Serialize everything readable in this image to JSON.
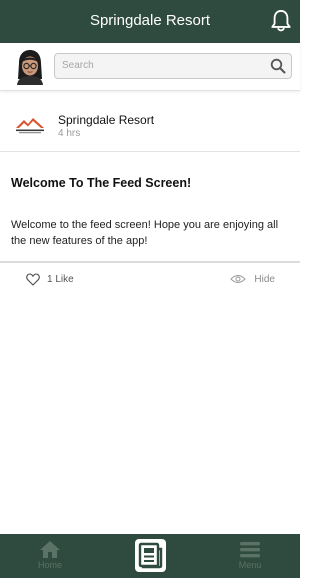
{
  "header": {
    "title": "Springdale Resort"
  },
  "search": {
    "placeholder": "Search"
  },
  "post": {
    "author": "Springdale Resort",
    "time": "4 hrs",
    "title": "Welcome To The Feed Screen!",
    "body": "Welcome to the feed screen! Hope you are enjoying all the new features of the app!",
    "likes_label": "1 Like",
    "hide_label": "Hide"
  },
  "nav": {
    "home_label": "Home",
    "menu_label": "Menu"
  },
  "colors": {
    "brand": "#2f4a3e",
    "nav_label": "#5b7266",
    "logo_accent": "#d8542e"
  },
  "icons": {
    "notification": "bell-icon",
    "search": "search-icon",
    "like": "heart-icon",
    "hide": "eye-icon",
    "home": "home-icon",
    "feed": "newspaper-icon",
    "menu": "hamburger-icon"
  }
}
